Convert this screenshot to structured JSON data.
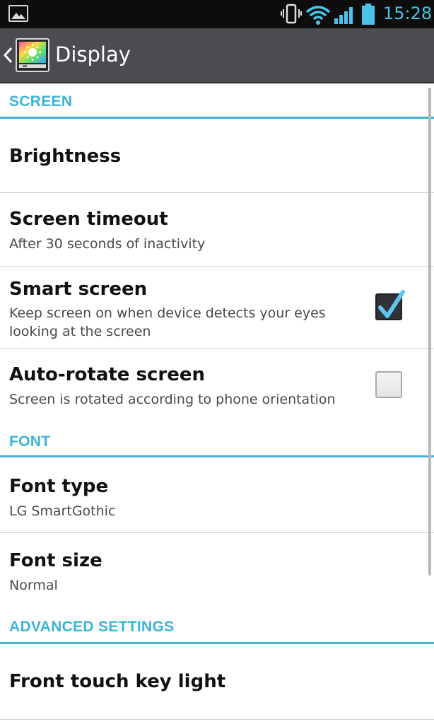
{
  "status_bar": {
    "time": "15:28",
    "icons": [
      "gallery-icon",
      "vibrate-icon",
      "wifi-icon",
      "signal-icon",
      "battery-icon"
    ],
    "accent_color": "#49c3e8"
  },
  "action_bar": {
    "title": "Display",
    "back_icon": "chevron-left-icon",
    "app_icon": "display-settings-icon"
  },
  "sections": {
    "screen": {
      "header": "SCREEN"
    },
    "font": {
      "header": "FONT"
    },
    "advanced": {
      "header": "ADVANCED SETTINGS"
    }
  },
  "items": {
    "brightness": {
      "title": "Brightness"
    },
    "screen_timeout": {
      "title": "Screen timeout",
      "summary": "After 30 seconds of inactivity"
    },
    "smart_screen": {
      "title": "Smart screen",
      "summary": "Keep screen on when device detects your eyes looking at the screen",
      "checked": true
    },
    "auto_rotate": {
      "title": "Auto-rotate screen",
      "summary": "Screen is rotated according to phone orientation",
      "checked": false
    },
    "font_type": {
      "title": "Font type",
      "summary": "LG SmartGothic"
    },
    "font_size": {
      "title": "Font size",
      "summary": "Normal"
    },
    "front_touch": {
      "title": "Front touch key light"
    }
  },
  "colors": {
    "section_header": "#3bb4d6",
    "action_bar_bg": "#4a4c4f",
    "status_bar_bg": "#0d0d0d"
  }
}
